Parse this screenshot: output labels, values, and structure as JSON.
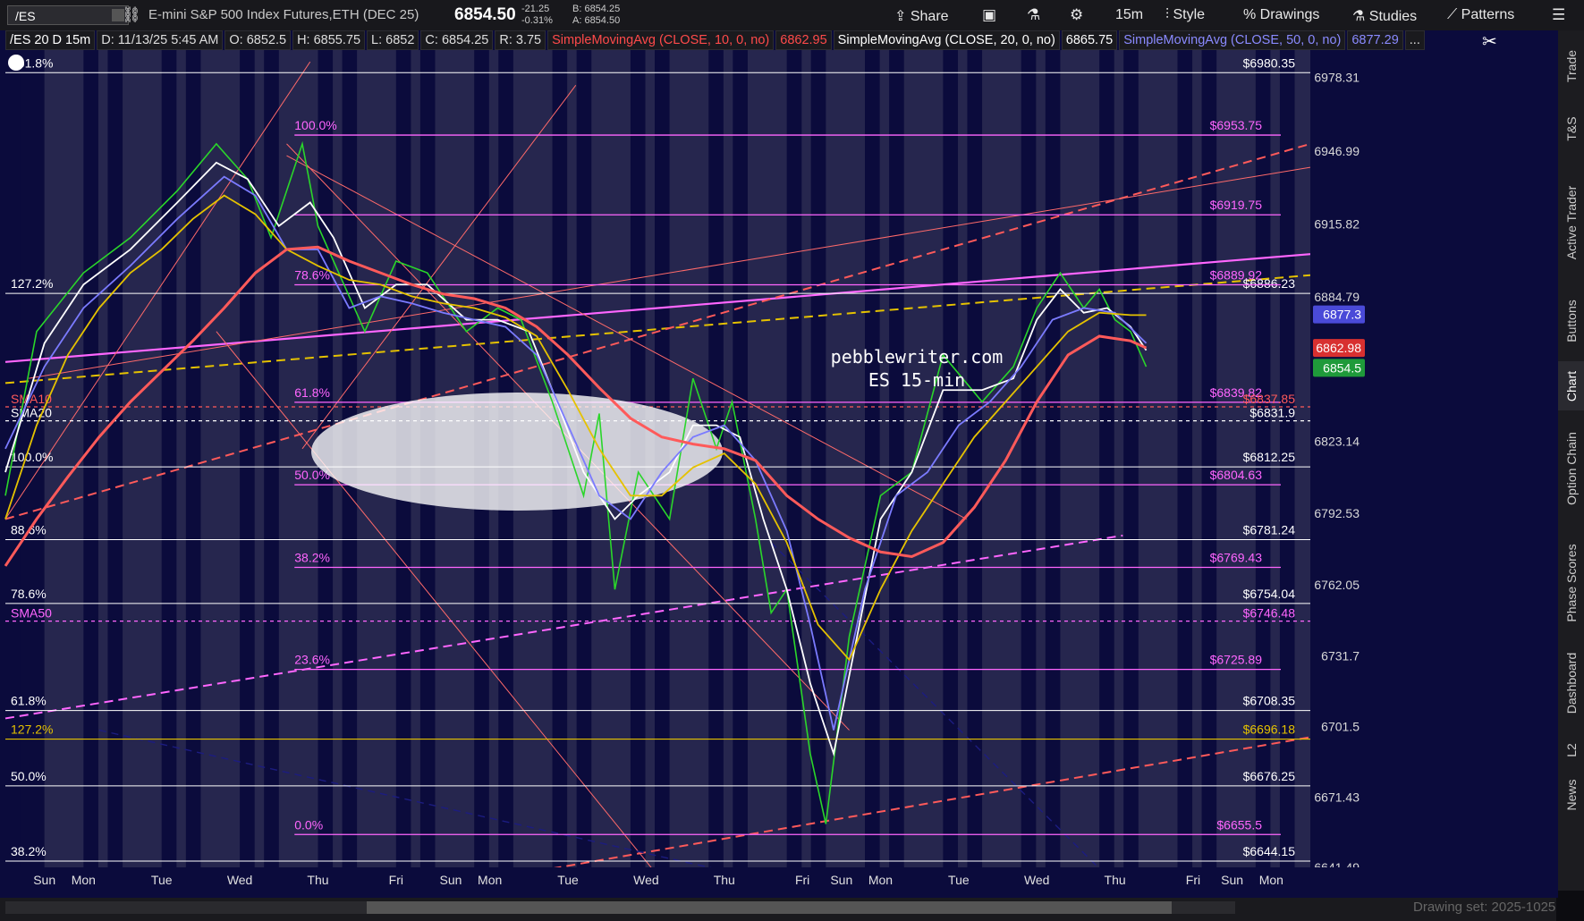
{
  "toolbar": {
    "symbol": "/ES",
    "instrument": "E-mini S&P 500 Index Futures,ETH (DEC 25)",
    "last_price": "6854.50",
    "change": "-21.25",
    "change_pct": "-0.31%",
    "bid": "B: 6854.25",
    "ask": "A: 6854.50",
    "share_label": "Share",
    "timeframe_label": "15m",
    "style_label": "Style",
    "drawings_label": "Drawings",
    "studies_label": "Studies",
    "patterns_label": "Patterns"
  },
  "info": {
    "chart_label": "/ES 20 D 15m",
    "date": "D: 11/13/25 5:45 AM",
    "open": "O: 6852.5",
    "high": "H: 6855.75",
    "low": "L: 6852",
    "close": "C: 6854.25",
    "range": "R: 3.75",
    "sma10_label": "SimpleMovingAvg (CLOSE, 10, 0, no)",
    "sma10_value": "6862.95",
    "sma20_label": "SimpleMovingAvg (CLOSE, 20, 0, no)",
    "sma20_value": "6865.75",
    "sma50_label": "SimpleMovingAvg (CLOSE, 50, 0, no)",
    "sma50_value": "6877.29",
    "more": "..."
  },
  "sidebar": {
    "tabs": [
      "Trade",
      "T&S",
      "Active Trader",
      "Buttons",
      "Chart",
      "Option Chain",
      "Phase Scores",
      "Dashboard",
      "L2",
      "News"
    ]
  },
  "bottom": {
    "drawing_set": "Drawing set: 2025-1025"
  },
  "watermark": {
    "line1": "pebblewriter.com",
    "line2": "ES 15-min"
  },
  "colors": {
    "sma10": "#ff5a5a",
    "sma20": "#ffffff",
    "sma50": "#7b7bff",
    "fib_pink": "#ff66ff",
    "gold": "#e5c200",
    "band_dark": "#0b0b3c",
    "band_light": "#26264e"
  },
  "chart_data": {
    "type": "line",
    "title": "/ES 20 D 15m",
    "ylim": [
      6641.49,
      6990
    ],
    "y_ticks": [
      "6978.31",
      "6946.99",
      "6915.82",
      "6884.79",
      "6854.5",
      "6823.14",
      "6792.53",
      "6762.05",
      "6731.7",
      "6701.5",
      "6671.43",
      "6641.49"
    ],
    "x_labels": [
      "Sun",
      "Mon",
      "Tue",
      "Wed",
      "Thu",
      "Fri",
      "Sun",
      "Mon",
      "Tue",
      "Wed",
      "Thu",
      "Fri",
      "Sun",
      "Mon",
      "Tue",
      "Wed",
      "Thu",
      "Fri",
      "Sun",
      "Mon"
    ],
    "x_positions": [
      0.5,
      1.0,
      2.0,
      3.0,
      4.0,
      5.0,
      5.7,
      6.2,
      7.2,
      8.2,
      9.2,
      10.2,
      10.7,
      11.2,
      12.2,
      13.2,
      14.2,
      15.2,
      15.7,
      16.2
    ],
    "fib_white": [
      {
        "label": "161.8%",
        "value": 6980.35,
        "price": "$6980.35"
      },
      {
        "label": "127.2%",
        "value": 6886.23,
        "price": "$6886.23"
      },
      {
        "label": "100.0%",
        "value": 6812.25,
        "price": "$6812.25"
      },
      {
        "label": "88.6%",
        "value": 6781.24,
        "price": "$6781.24"
      },
      {
        "label": "78.6%",
        "value": 6754.04,
        "price": "$6754.04"
      },
      {
        "label": "61.8%",
        "value": 6708.35,
        "price": "$6708.35"
      },
      {
        "label": "50.0%",
        "value": 6676.25,
        "price": "$6676.25"
      },
      {
        "label": "38.2%",
        "value": 6644.15,
        "price": "$6644.15"
      }
    ],
    "fib_pink": [
      {
        "label": "100.0%",
        "value": 6953.75,
        "price": "$6953.75"
      },
      {
        "label": "",
        "value": 6919.75,
        "price": "$6919.75"
      },
      {
        "label": "78.6%",
        "value": 6889.92,
        "price": "$6889.92"
      },
      {
        "label": "61.8%",
        "value": 6839.82,
        "price": "$6839.82"
      },
      {
        "label": "50.0%",
        "value": 6804.63,
        "price": "$6804.63"
      },
      {
        "label": "38.2%",
        "value": 6769.43,
        "price": "$6769.43"
      },
      {
        "label": "23.6%",
        "value": 6725.89,
        "price": "$6725.89"
      },
      {
        "label": "0.0%",
        "value": 6655.5,
        "price": "$6655.5"
      }
    ],
    "fib_gold": {
      "label": "127.2%",
      "value": 6696.18,
      "price": "$6696.18"
    },
    "sma_levels": [
      {
        "name": "SMA10",
        "value": 6837.85,
        "price": "$6837.85",
        "color": "#ff5a5a"
      },
      {
        "name": "SMA20",
        "value": 6831.9,
        "price": "$6831.9",
        "color": "#ffffff"
      },
      {
        "name": "SMA50",
        "value": 6746.48,
        "price": "$6746.48",
        "color": "#ff66ff"
      }
    ],
    "price_badges": [
      {
        "value": 6877.3,
        "label": "6877.3",
        "color": "#4a4ad8"
      },
      {
        "value": 6862.98,
        "label": "6862.98",
        "color": "#d83030"
      },
      {
        "value": 6854.5,
        "label": "6854.5",
        "color": "#1f9a3a"
      }
    ],
    "series": [
      {
        "name": "Price",
        "color": "#2ad62a",
        "x": [
          0.0,
          0.4,
          1.0,
          1.6,
          2.2,
          2.7,
          3.1,
          3.4,
          3.8,
          4.0,
          4.2,
          4.6,
          5.0,
          5.4,
          5.9,
          6.3,
          6.6,
          7.0,
          7.4,
          7.6,
          7.8,
          8.1,
          8.5,
          8.8,
          9.1,
          9.3,
          9.6,
          9.8,
          10.0,
          10.3,
          10.5,
          10.8,
          11.2,
          11.6,
          12.0,
          12.5,
          12.9,
          13.2,
          13.5,
          13.8,
          14.0,
          14.2,
          14.4,
          14.6
        ],
        "y": [
          6800,
          6870,
          6895,
          6910,
          6930,
          6950,
          6935,
          6910,
          6950,
          6915,
          6900,
          6870,
          6900,
          6895,
          6870,
          6880,
          6875,
          6840,
          6800,
          6835,
          6760,
          6810,
          6790,
          6850,
          6820,
          6840,
          6790,
          6750,
          6760,
          6690,
          6660,
          6740,
          6800,
          6810,
          6860,
          6840,
          6855,
          6880,
          6895,
          6880,
          6888,
          6875,
          6870,
          6855
        ]
      },
      {
        "name": "SMA10",
        "color": "#ffffff",
        "x": [
          0.0,
          0.5,
          1.0,
          1.6,
          2.2,
          2.7,
          3.1,
          3.5,
          3.9,
          4.2,
          4.6,
          5.0,
          5.4,
          5.9,
          6.3,
          6.7,
          7.0,
          7.4,
          7.8,
          8.1,
          8.5,
          8.8,
          9.1,
          9.4,
          9.7,
          10.0,
          10.3,
          10.6,
          10.9,
          11.2,
          11.6,
          12.0,
          12.5,
          12.9,
          13.2,
          13.5,
          13.8,
          14.1,
          14.4,
          14.6
        ],
        "y": [
          6810,
          6865,
          6890,
          6905,
          6925,
          6942,
          6935,
          6915,
          6925,
          6910,
          6880,
          6890,
          6890,
          6875,
          6875,
          6870,
          6845,
          6810,
          6790,
          6800,
          6810,
          6830,
          6830,
          6825,
          6790,
          6760,
          6720,
          6690,
          6740,
          6790,
          6810,
          6845,
          6845,
          6850,
          6875,
          6888,
          6878,
          6880,
          6872,
          6862
        ]
      },
      {
        "name": "SMA20",
        "color": "#7b7bff",
        "x": [
          0.0,
          0.5,
          1.0,
          1.6,
          2.2,
          2.8,
          3.2,
          3.6,
          4.0,
          4.4,
          4.8,
          5.2,
          5.6,
          6.0,
          6.4,
          6.8,
          7.2,
          7.6,
          8.0,
          8.4,
          8.8,
          9.2,
          9.6,
          10.0,
          10.3,
          10.6,
          11.0,
          11.4,
          11.8,
          12.2,
          12.6,
          13.0,
          13.4,
          13.8,
          14.2,
          14.6
        ],
        "y": [
          6820,
          6855,
          6880,
          6898,
          6918,
          6936,
          6928,
          6905,
          6905,
          6880,
          6885,
          6882,
          6878,
          6875,
          6872,
          6860,
          6830,
          6800,
          6790,
          6810,
          6825,
          6830,
          6815,
          6785,
          6745,
          6700,
          6760,
          6800,
          6810,
          6830,
          6840,
          6855,
          6875,
          6880,
          6878,
          6865
        ]
      },
      {
        "name": "SMA50",
        "color": "#e5c200",
        "x": [
          0.0,
          0.4,
          0.8,
          1.2,
          1.6,
          2.0,
          2.4,
          2.8,
          3.2,
          3.6,
          4.0,
          4.4,
          4.8,
          5.2,
          5.6,
          6.0,
          6.4,
          6.8,
          7.2,
          7.6,
          8.0,
          8.4,
          8.8,
          9.2,
          9.6,
          10.0,
          10.4,
          10.8,
          11.2,
          11.6,
          12.0,
          12.4,
          12.8,
          13.2,
          13.6,
          14.0,
          14.4,
          14.6
        ],
        "y": [
          6790,
          6830,
          6860,
          6880,
          6895,
          6905,
          6918,
          6928,
          6920,
          6905,
          6898,
          6892,
          6890,
          6885,
          6882,
          6880,
          6876,
          6868,
          6845,
          6820,
          6800,
          6800,
          6812,
          6818,
          6805,
          6780,
          6745,
          6730,
          6760,
          6785,
          6805,
          6825,
          6840,
          6855,
          6870,
          6878,
          6877,
          6877
        ]
      },
      {
        "name": "SMA200",
        "color": "#ff5a5a",
        "x": [
          0.0,
          0.4,
          0.8,
          1.2,
          1.6,
          2.0,
          2.4,
          2.8,
          3.2,
          3.6,
          4.0,
          4.4,
          4.8,
          5.2,
          5.6,
          6.0,
          6.4,
          6.8,
          7.2,
          7.6,
          8.0,
          8.4,
          8.8,
          9.2,
          9.6,
          10.0,
          10.4,
          10.8,
          11.2,
          11.6,
          12.0,
          12.4,
          12.8,
          13.2,
          13.6,
          14.0,
          14.4,
          14.6
        ],
        "y": [
          6770,
          6790,
          6808,
          6825,
          6840,
          6853,
          6866,
          6880,
          6895,
          6905,
          6906,
          6900,
          6895,
          6890,
          6886,
          6884,
          6880,
          6872,
          6860,
          6846,
          6833,
          6825,
          6822,
          6820,
          6815,
          6800,
          6790,
          6782,
          6776,
          6774,
          6780,
          6795,
          6815,
          6840,
          6860,
          6868,
          6866,
          6863
        ]
      }
    ]
  }
}
